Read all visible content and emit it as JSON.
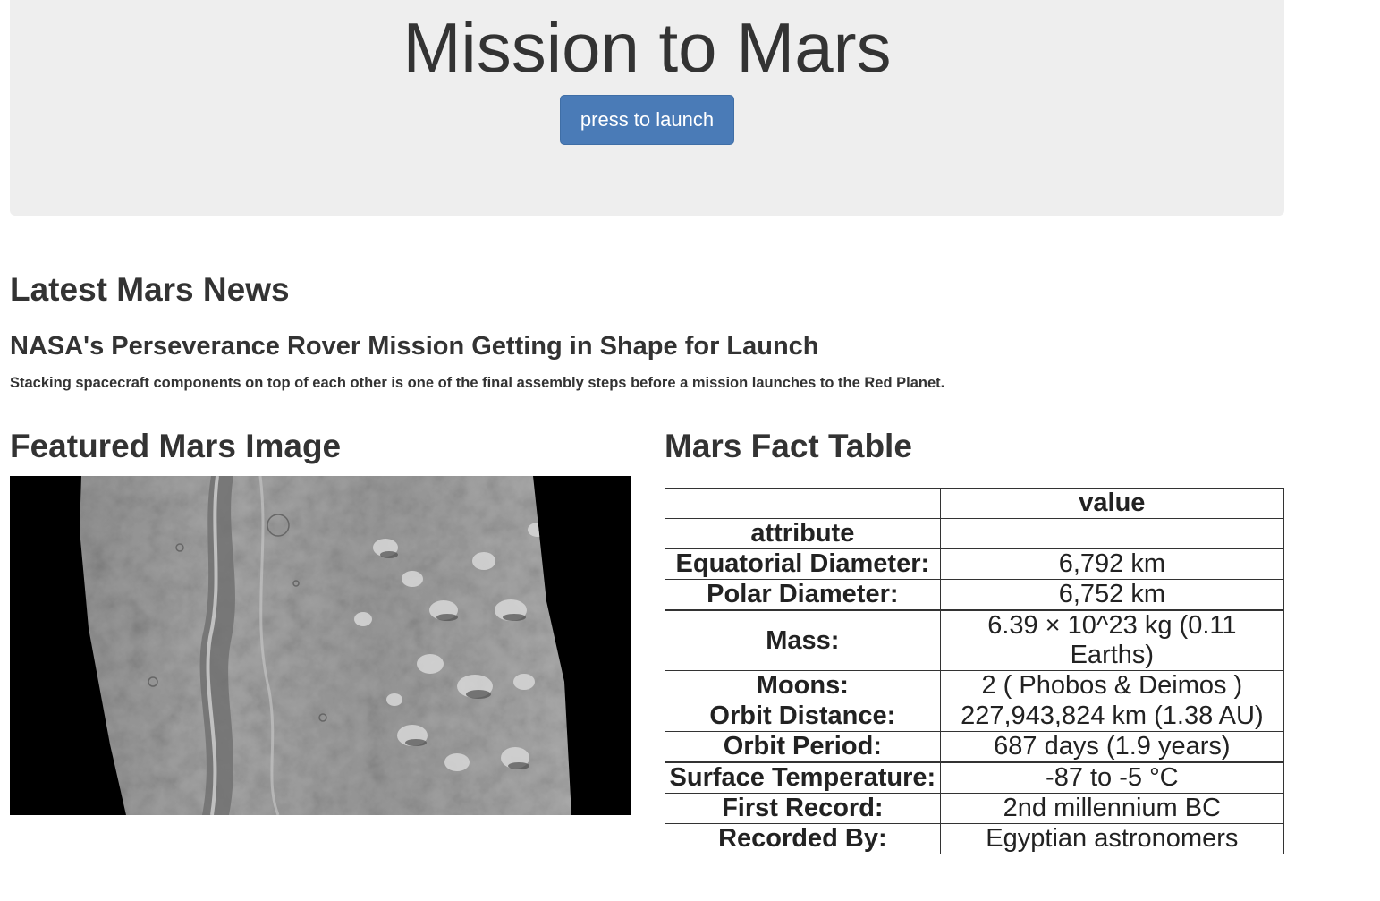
{
  "header": {
    "title": "Mission to Mars",
    "launch_label": "press to launch",
    "button_color": "#4a7bb7",
    "background_color": "#eeeeee"
  },
  "news": {
    "heading": "Latest Mars News",
    "title": "NASA's Perseverance Rover Mission Getting in Shape for Launch",
    "teaser": "Stacking spacecraft components on top of each other is one of the final assembly steps before a mission launches to the Red Planet."
  },
  "featured_image": {
    "heading": "Featured Mars Image"
  },
  "facts": {
    "heading": "Mars Fact Table",
    "value_header": "value",
    "attribute_header": "attribute",
    "rows": [
      {
        "attribute": "Equatorial Diameter:",
        "value": "6,792 km"
      },
      {
        "attribute": "Polar Diameter:",
        "value": "6,752 km"
      },
      {
        "attribute": "Mass:",
        "value": "6.39 × 10^23 kg (0.11 Earths)"
      },
      {
        "attribute": "Moons:",
        "value": "2 ( Phobos & Deimos )"
      },
      {
        "attribute": "Orbit Distance:",
        "value": "227,943,824 km (1.38 AU)"
      },
      {
        "attribute": "Orbit Period:",
        "value": "687 days (1.9 years)"
      },
      {
        "attribute": "Surface Temperature:",
        "value": "-87 to -5 °C"
      },
      {
        "attribute": "First Record:",
        "value": "2nd millennium BC"
      },
      {
        "attribute": "Recorded By:",
        "value": "Egyptian astronomers"
      }
    ]
  }
}
